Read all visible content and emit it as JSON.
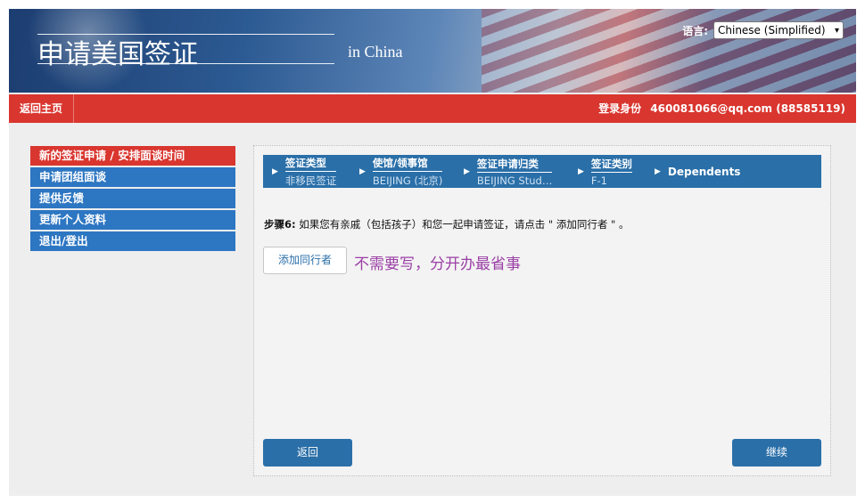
{
  "header": {
    "title": "申请美国签证",
    "subtitle": "in China",
    "language_label": "语言:",
    "language_selected": "Chinese (Simplified)"
  },
  "navbar": {
    "home": "返回主页",
    "login_label": "登录身份",
    "login_user": "460081066@qq.com (88585119)"
  },
  "sidebar": {
    "items": [
      {
        "label": "新的签证申请 / 安排面谈时间",
        "active": true
      },
      {
        "label": "申请团组面谈",
        "active": false
      },
      {
        "label": "提供反馈",
        "active": false
      },
      {
        "label": "更新个人资料",
        "active": false
      },
      {
        "label": "退出/登出",
        "active": false
      }
    ]
  },
  "steps": [
    {
      "label": "签证类型",
      "value": "非移民签证"
    },
    {
      "label": "使馆/领事馆",
      "value": "BEIJING (北京)"
    },
    {
      "label": "签证申请归类",
      "value": "BEIJING Stud…"
    },
    {
      "label": "签证类别",
      "value": "F-1"
    },
    {
      "label": "Dependents",
      "value": ""
    }
  ],
  "main": {
    "step_prefix": "步骤6:",
    "instruction": "如果您有亲戚（包括孩子）和您一起申请签证，请点击 \" 添加同行者 \" 。",
    "add_button": "添加同行者",
    "annotation": "不需要写，分开办最省事",
    "back_button": "返回",
    "next_button": "继续"
  },
  "colors": {
    "nav_red": "#d9362f",
    "menu_blue": "#2d76c2",
    "step_blue": "#2a6fa8",
    "annotation_purple": "#9b3fa6"
  }
}
